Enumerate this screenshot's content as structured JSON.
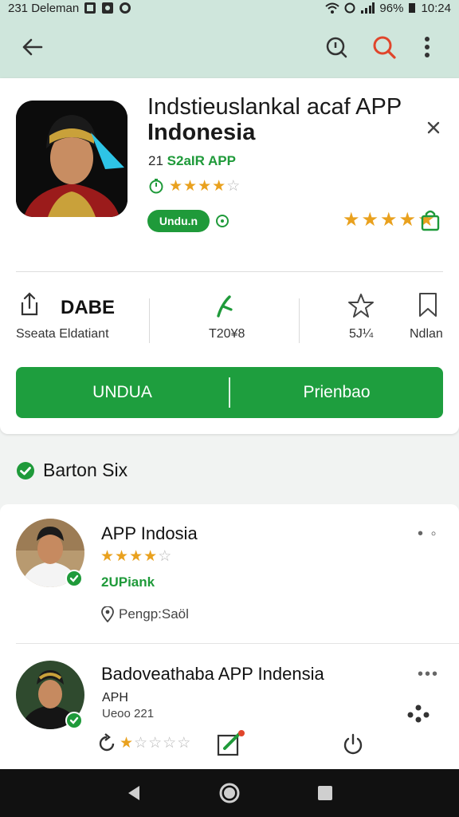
{
  "status_bar": {
    "left_text": "231 Deleman",
    "battery": "96%",
    "time": "10:24"
  },
  "app": {
    "title_line1": "Indstieuslankal acaf APP",
    "title_line2": "Indonesia",
    "dev_prefix": "21",
    "dev_name": "S2aIR APP",
    "rating_stars": 3.5,
    "pill_label": "Undu.n",
    "big_rating_stars": 4.5
  },
  "stats": [
    {
      "value": "DABE",
      "label": "Sseata Eldatiant"
    },
    {
      "value": "",
      "label": "T20¥8"
    },
    {
      "value": "",
      "label": "5J¼"
    },
    {
      "value": "",
      "label": "Ndlan"
    }
  ],
  "actions": {
    "primary": "UNDUA",
    "secondary": "Prienbao"
  },
  "section": {
    "title": "Barton Six"
  },
  "list": [
    {
      "title": "APP Indosia",
      "rating_stars": 3.5,
      "sub": "2UPiank",
      "location": "Pengp:Saöl"
    },
    {
      "title": "Badoveathaba APP Indensia",
      "meta1": "APH",
      "meta2": "Ueoo 221",
      "rating_stars": 1
    }
  ],
  "colors": {
    "accent_green": "#1f9a3a",
    "header_bg": "#cfe6dc",
    "star": "#e9a11e"
  }
}
